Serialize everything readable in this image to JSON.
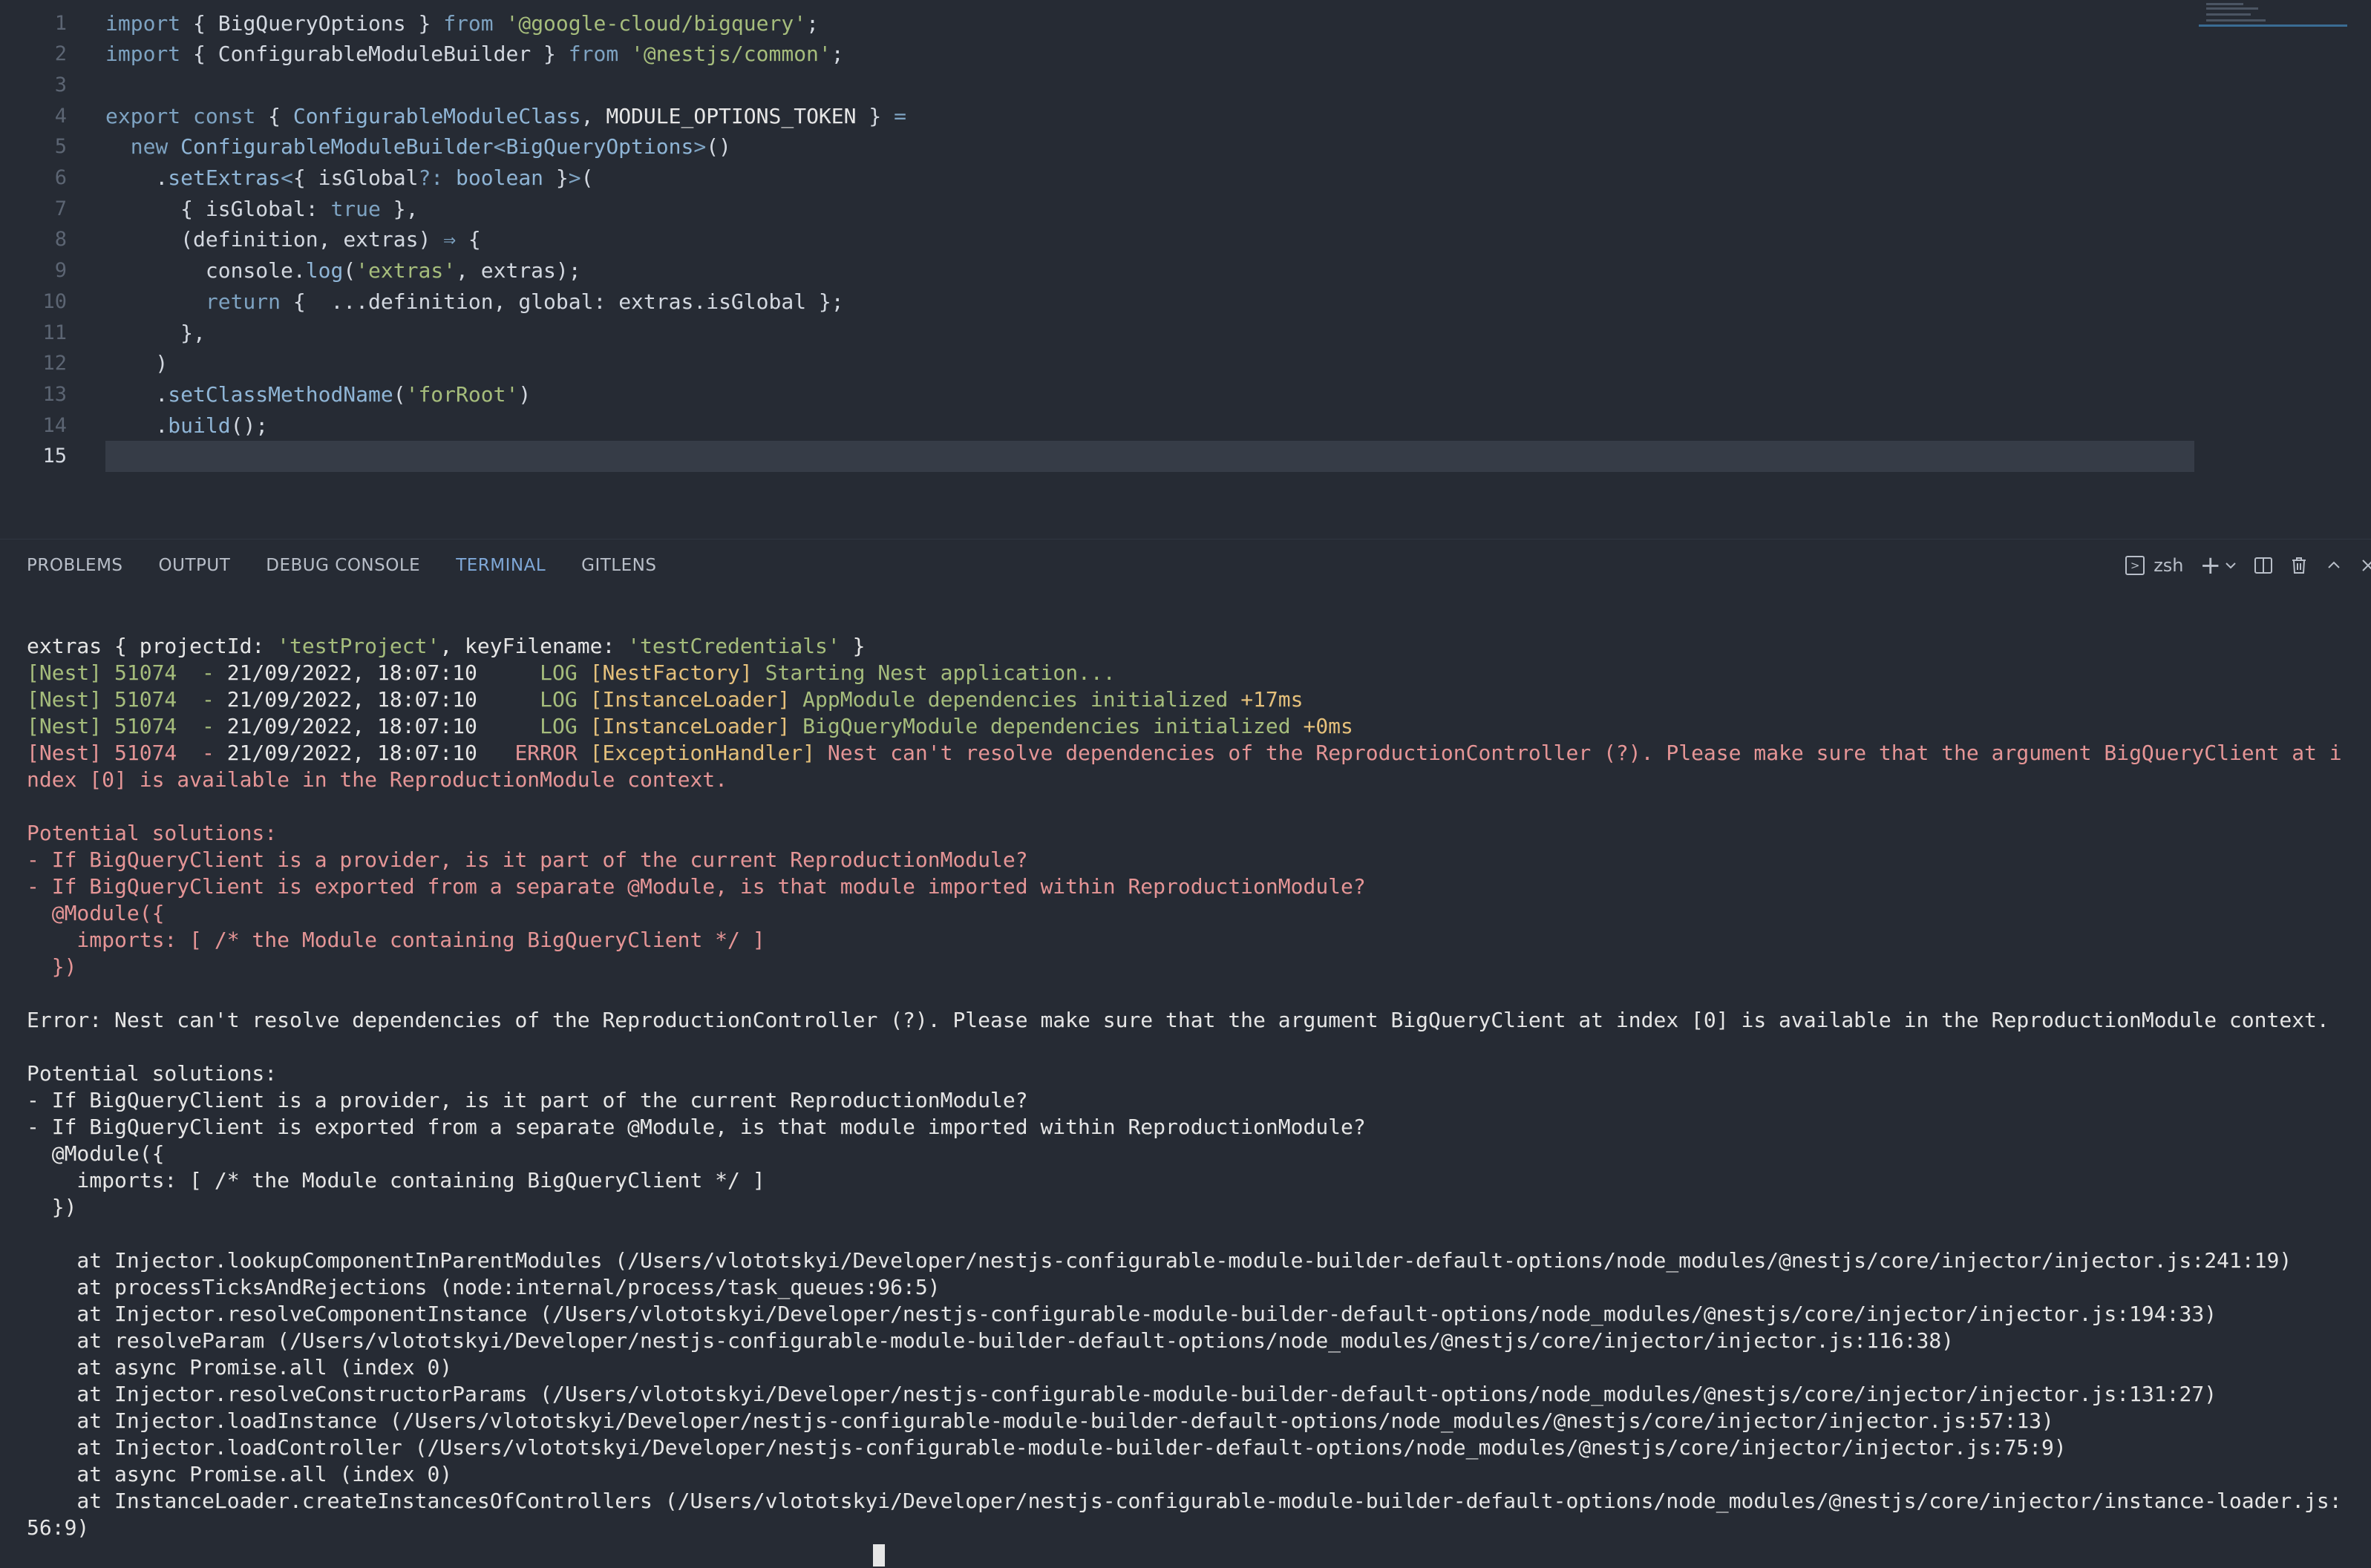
{
  "editor": {
    "current_line": 15,
    "lines": [
      {
        "n": "1",
        "tokens": [
          [
            "kw",
            "import"
          ],
          [
            "punc",
            " { "
          ],
          [
            "id",
            "BigQueryOptions"
          ],
          [
            "punc",
            " } "
          ],
          [
            "kw",
            "from"
          ],
          [
            "punc",
            " "
          ],
          [
            "str",
            "'@google-cloud/bigquery'"
          ],
          [
            "punc",
            ";"
          ]
        ]
      },
      {
        "n": "2",
        "tokens": [
          [
            "kw",
            "import"
          ],
          [
            "punc",
            " { "
          ],
          [
            "id",
            "ConfigurableModuleBuilder"
          ],
          [
            "punc",
            " } "
          ],
          [
            "kw",
            "from"
          ],
          [
            "punc",
            " "
          ],
          [
            "str",
            "'@nestjs/common'"
          ],
          [
            "punc",
            ";"
          ]
        ]
      },
      {
        "n": "3",
        "tokens": []
      },
      {
        "n": "4",
        "tokens": [
          [
            "kw",
            "export"
          ],
          [
            "punc",
            " "
          ],
          [
            "kw",
            "const"
          ],
          [
            "punc",
            " { "
          ],
          [
            "type",
            "ConfigurableModuleClass"
          ],
          [
            "punc",
            ", "
          ],
          [
            "const",
            "MODULE_OPTIONS_TOKEN"
          ],
          [
            "punc",
            " } "
          ],
          [
            "op",
            "="
          ]
        ]
      },
      {
        "n": "5",
        "tokens": [
          [
            "punc",
            "  "
          ],
          [
            "kw",
            "new"
          ],
          [
            "punc",
            " "
          ],
          [
            "type",
            "ConfigurableModuleBuilder"
          ],
          [
            "op",
            "<"
          ],
          [
            "type",
            "BigQueryOptions"
          ],
          [
            "op",
            ">"
          ],
          [
            "punc",
            "()"
          ]
        ]
      },
      {
        "n": "6",
        "tokens": [
          [
            "punc",
            "    ."
          ],
          [
            "fn",
            "setExtras"
          ],
          [
            "op",
            "<"
          ],
          [
            "punc",
            "{ "
          ],
          [
            "id",
            "isGlobal"
          ],
          [
            "op",
            "?:"
          ],
          [
            "punc",
            " "
          ],
          [
            "type",
            "boolean"
          ],
          [
            "punc",
            " }"
          ],
          [
            "op",
            ">"
          ],
          [
            "punc",
            "("
          ]
        ]
      },
      {
        "n": "7",
        "tokens": [
          [
            "punc",
            "      { "
          ],
          [
            "id",
            "isGlobal"
          ],
          [
            "punc",
            ": "
          ],
          [
            "kw",
            "true"
          ],
          [
            "punc",
            " },"
          ]
        ]
      },
      {
        "n": "8",
        "tokens": [
          [
            "punc",
            "      ("
          ],
          [
            "id",
            "definition"
          ],
          [
            "punc",
            ", "
          ],
          [
            "id",
            "extras"
          ],
          [
            "punc",
            ") "
          ],
          [
            "op",
            "⇒"
          ],
          [
            "punc",
            " {"
          ]
        ]
      },
      {
        "n": "9",
        "tokens": [
          [
            "punc",
            "        "
          ],
          [
            "id",
            "console"
          ],
          [
            "punc",
            "."
          ],
          [
            "fn",
            "log"
          ],
          [
            "punc",
            "("
          ],
          [
            "str",
            "'extras'"
          ],
          [
            "punc",
            ", "
          ],
          [
            "id",
            "extras"
          ],
          [
            "punc",
            ");"
          ]
        ]
      },
      {
        "n": "10",
        "tokens": [
          [
            "punc",
            "        "
          ],
          [
            "kw",
            "return"
          ],
          [
            "punc",
            " {  ..."
          ],
          [
            "id",
            "definition"
          ],
          [
            "punc",
            ", "
          ],
          [
            "id",
            "global"
          ],
          [
            "punc",
            ": "
          ],
          [
            "id",
            "extras"
          ],
          [
            "punc",
            "."
          ],
          [
            "id",
            "isGlobal"
          ],
          [
            "punc",
            " };"
          ]
        ]
      },
      {
        "n": "11",
        "tokens": [
          [
            "punc",
            "      },"
          ]
        ]
      },
      {
        "n": "12",
        "tokens": [
          [
            "punc",
            "    )"
          ]
        ]
      },
      {
        "n": "13",
        "tokens": [
          [
            "punc",
            "    ."
          ],
          [
            "fn",
            "setClassMethodName"
          ],
          [
            "punc",
            "("
          ],
          [
            "str",
            "'forRoot'"
          ],
          [
            "punc",
            ")"
          ]
        ]
      },
      {
        "n": "14",
        "tokens": [
          [
            "punc",
            "    ."
          ],
          [
            "fn",
            "build"
          ],
          [
            "punc",
            "();"
          ]
        ]
      },
      {
        "n": "15",
        "tokens": []
      }
    ]
  },
  "panel": {
    "tabs": [
      {
        "label": "PROBLEMS",
        "active": false
      },
      {
        "label": "OUTPUT",
        "active": false
      },
      {
        "label": "DEBUG CONSOLE",
        "active": false
      },
      {
        "label": "TERMINAL",
        "active": true
      },
      {
        "label": "GITLENS",
        "active": false
      }
    ],
    "shell_name": "zsh",
    "icons": [
      "terminal-icon",
      "add-terminal-icon",
      "chevron-down-icon",
      "split-terminal-icon",
      "trash-icon",
      "maximize-panel-icon",
      "close-icon"
    ]
  },
  "terminal": {
    "lines": [
      [
        [
          "white",
          "extras { projectId: "
        ],
        [
          "str",
          "'testProject'"
        ],
        [
          "white",
          ", keyFilename: "
        ],
        [
          "str",
          "'testCredentials'"
        ],
        [
          "white",
          " }"
        ]
      ],
      [
        [
          "green",
          "[Nest] 51074  - "
        ],
        [
          "white",
          "21/09/2022, 18:07:10     "
        ],
        [
          "green",
          "LOG "
        ],
        [
          "yellow",
          "[NestFactory] "
        ],
        [
          "green",
          "Starting Nest application..."
        ]
      ],
      [
        [
          "green",
          "[Nest] 51074  - "
        ],
        [
          "white",
          "21/09/2022, 18:07:10     "
        ],
        [
          "green",
          "LOG "
        ],
        [
          "yellow",
          "[InstanceLoader] "
        ],
        [
          "green",
          "AppModule dependencies initialized "
        ],
        [
          "yellow",
          "+17ms"
        ]
      ],
      [
        [
          "green",
          "[Nest] 51074  - "
        ],
        [
          "white",
          "21/09/2022, 18:07:10     "
        ],
        [
          "green",
          "LOG "
        ],
        [
          "yellow",
          "[InstanceLoader] "
        ],
        [
          "green",
          "BigQueryModule dependencies initialized "
        ],
        [
          "yellow",
          "+0ms"
        ]
      ],
      [
        [
          "red",
          "[Nest] 51074  - "
        ],
        [
          "white",
          "21/09/2022, 18:07:10   "
        ],
        [
          "red",
          "ERROR "
        ],
        [
          "yellow",
          "[ExceptionHandler] "
        ],
        [
          "red",
          "Nest can't resolve dependencies of the ReproductionController (?). Please make sure that the argument BigQueryClient at i"
        ]
      ],
      [
        [
          "red",
          "ndex [0] is available in the ReproductionModule context."
        ]
      ],
      [
        [
          "white",
          ""
        ]
      ],
      [
        [
          "red",
          "Potential solutions:"
        ]
      ],
      [
        [
          "red",
          "- If BigQueryClient is a provider, is it part of the current ReproductionModule?"
        ]
      ],
      [
        [
          "red",
          "- If BigQueryClient is exported from a separate @Module, is that module imported within ReproductionModule?"
        ]
      ],
      [
        [
          "red",
          "  @Module({"
        ]
      ],
      [
        [
          "red",
          "    imports: [ /* the Module containing BigQueryClient */ ]"
        ]
      ],
      [
        [
          "red",
          "  })"
        ]
      ],
      [
        [
          "white",
          ""
        ]
      ],
      [
        [
          "white",
          "Error: Nest can't resolve dependencies of the ReproductionController (?). Please make sure that the argument BigQueryClient at index [0] is available in the ReproductionModule context."
        ]
      ],
      [
        [
          "white",
          ""
        ]
      ],
      [
        [
          "white",
          "Potential solutions:"
        ]
      ],
      [
        [
          "white",
          "- If BigQueryClient is a provider, is it part of the current ReproductionModule?"
        ]
      ],
      [
        [
          "white",
          "- If BigQueryClient is exported from a separate @Module, is that module imported within ReproductionModule?"
        ]
      ],
      [
        [
          "white",
          "  @Module({"
        ]
      ],
      [
        [
          "white",
          "    imports: [ /* the Module containing BigQueryClient */ ]"
        ]
      ],
      [
        [
          "white",
          "  })"
        ]
      ],
      [
        [
          "white",
          ""
        ]
      ],
      [
        [
          "white",
          "    at Injector.lookupComponentInParentModules (/Users/vlototskyi/Developer/nestjs-configurable-module-builder-default-options/node_modules/@nestjs/core/injector/injector.js:241:19)"
        ]
      ],
      [
        [
          "white",
          "    at processTicksAndRejections (node:internal/process/task_queues:96:5)"
        ]
      ],
      [
        [
          "white",
          "    at Injector.resolveComponentInstance (/Users/vlototskyi/Developer/nestjs-configurable-module-builder-default-options/node_modules/@nestjs/core/injector/injector.js:194:33)"
        ]
      ],
      [
        [
          "white",
          "    at resolveParam (/Users/vlototskyi/Developer/nestjs-configurable-module-builder-default-options/node_modules/@nestjs/core/injector/injector.js:116:38)"
        ]
      ],
      [
        [
          "white",
          "    at async Promise.all (index 0)"
        ]
      ],
      [
        [
          "white",
          "    at Injector.resolveConstructorParams (/Users/vlototskyi/Developer/nestjs-configurable-module-builder-default-options/node_modules/@nestjs/core/injector/injector.js:131:27)"
        ]
      ],
      [
        [
          "white",
          "    at Injector.loadInstance (/Users/vlototskyi/Developer/nestjs-configurable-module-builder-default-options/node_modules/@nestjs/core/injector/injector.js:57:13)"
        ]
      ],
      [
        [
          "white",
          "    at Injector.loadController (/Users/vlototskyi/Developer/nestjs-configurable-module-builder-default-options/node_modules/@nestjs/core/injector/injector.js:75:9)"
        ]
      ],
      [
        [
          "white",
          "    at async Promise.all (index 0)"
        ]
      ],
      [
        [
          "white",
          "    at InstanceLoader.createInstancesOfControllers (/Users/vlototskyi/Developer/nestjs-configurable-module-builder-default-options/node_modules/@nestjs/core/injector/instance-loader.js:"
        ]
      ],
      [
        [
          "white",
          "56:9)"
        ]
      ]
    ]
  }
}
